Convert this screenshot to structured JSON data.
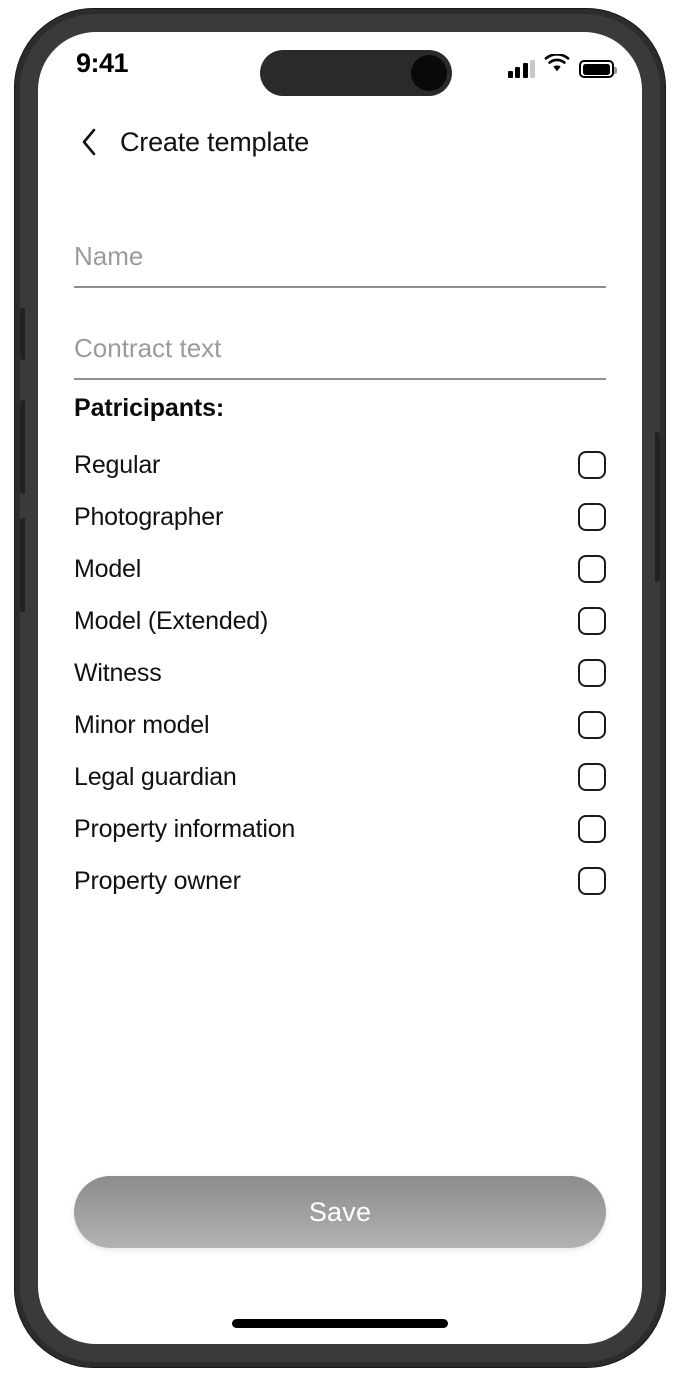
{
  "status_bar": {
    "time": "9:41",
    "cellular_icon": "signal-bars-icon",
    "wifi_icon": "wifi-icon",
    "battery_icon": "battery-icon"
  },
  "nav": {
    "back_icon": "chevron-left-icon",
    "title": "Create template"
  },
  "form": {
    "fields": [
      {
        "name": "name",
        "value": "",
        "placeholder": "Name"
      },
      {
        "name": "contract_text",
        "value": "",
        "placeholder": "Contract text"
      }
    ]
  },
  "participants": {
    "heading": "Patricipants:",
    "items": [
      {
        "label": "Regular",
        "checked": false
      },
      {
        "label": "Photographer",
        "checked": false
      },
      {
        "label": "Model",
        "checked": false
      },
      {
        "label": "Model (Extended)",
        "checked": false
      },
      {
        "label": "Witness",
        "checked": false
      },
      {
        "label": "Minor model",
        "checked": false
      },
      {
        "label": "Legal guardian",
        "checked": false
      },
      {
        "label": "Property information",
        "checked": false
      },
      {
        "label": "Property owner",
        "checked": false
      }
    ]
  },
  "footer": {
    "save_label": "Save"
  },
  "colors": {
    "screen_background": "#ffffff",
    "device_bezel": "#2c2c2c",
    "text_primary": "#111111",
    "placeholder": "#9b9b9b",
    "divider": "#8d8d8d",
    "save_gradient_top": "#8d8d8d",
    "save_gradient_bottom": "#b3b3b3",
    "checkbox_border": "#1a1a1a"
  }
}
